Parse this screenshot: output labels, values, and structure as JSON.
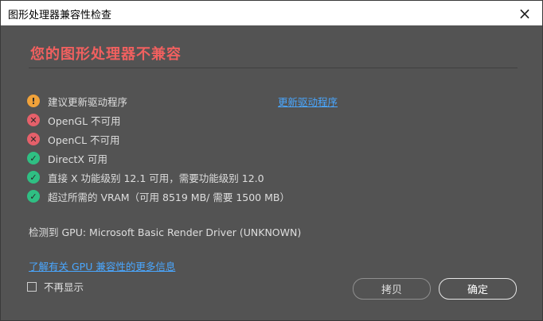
{
  "window": {
    "title": "图形处理器兼容性检查",
    "close_icon": "×"
  },
  "heading": "您的图形处理器不兼容",
  "colors": {
    "heading": "#f0605f",
    "warning": "#f0a23a",
    "error": "#e5606a",
    "ok": "#2fbf83",
    "link": "#4aa7ff"
  },
  "checks": [
    {
      "status": "warning",
      "icon": "warning-icon",
      "glyph": "!",
      "text": "建议更新驱动程序"
    },
    {
      "status": "error",
      "icon": "error-icon",
      "glyph": "✕",
      "text": "OpenGL 不可用"
    },
    {
      "status": "error",
      "icon": "error-icon",
      "glyph": "✕",
      "text": "OpenCL 不可用"
    },
    {
      "status": "ok",
      "icon": "check-icon",
      "glyph": "✓",
      "text": "DirectX 可用"
    },
    {
      "status": "ok",
      "icon": "check-icon",
      "glyph": "✓",
      "text": "直接 X 功能级别 12.1 可用，需要功能级别 12.0"
    },
    {
      "status": "ok",
      "icon": "check-icon",
      "glyph": "✓",
      "text": "超过所需的 VRAM（可用 8519 MB/ 需要 1500 MB）"
    }
  ],
  "update_driver_link": "更新驱动程序",
  "gpu_detected": "检测到 GPU: Microsoft Basic Render Driver (UNKNOWN)",
  "more_info_link": "了解有关 GPU 兼容性的更多信息",
  "dont_show_again": {
    "label": "不再显示",
    "checked": false
  },
  "buttons": {
    "copy": "拷贝",
    "ok": "确定"
  }
}
